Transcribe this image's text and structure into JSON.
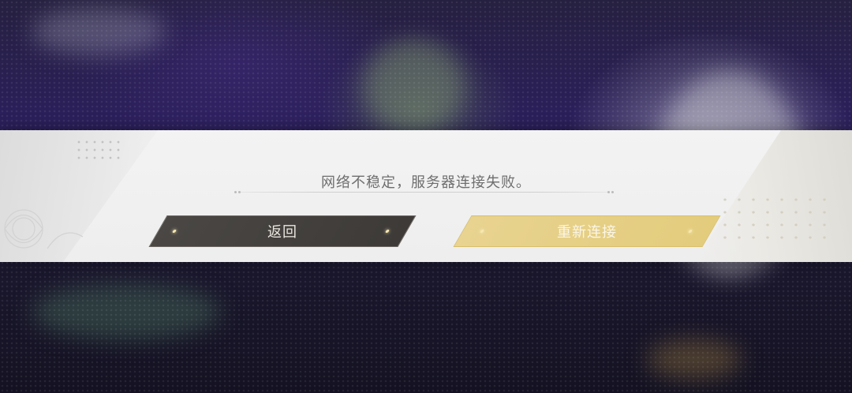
{
  "dialog": {
    "message": "网络不稳定，服务器连接失败。",
    "back_button_label": "返回",
    "reconnect_button_label": "重新连接"
  },
  "colors": {
    "banner": "#f0f0f0",
    "back_button": "#423f3c",
    "reconnect_button": "#e6cf86",
    "message_text": "#6e6e6e"
  },
  "icons": [
    "sparkle-icon",
    "decorative-flower-icon"
  ]
}
